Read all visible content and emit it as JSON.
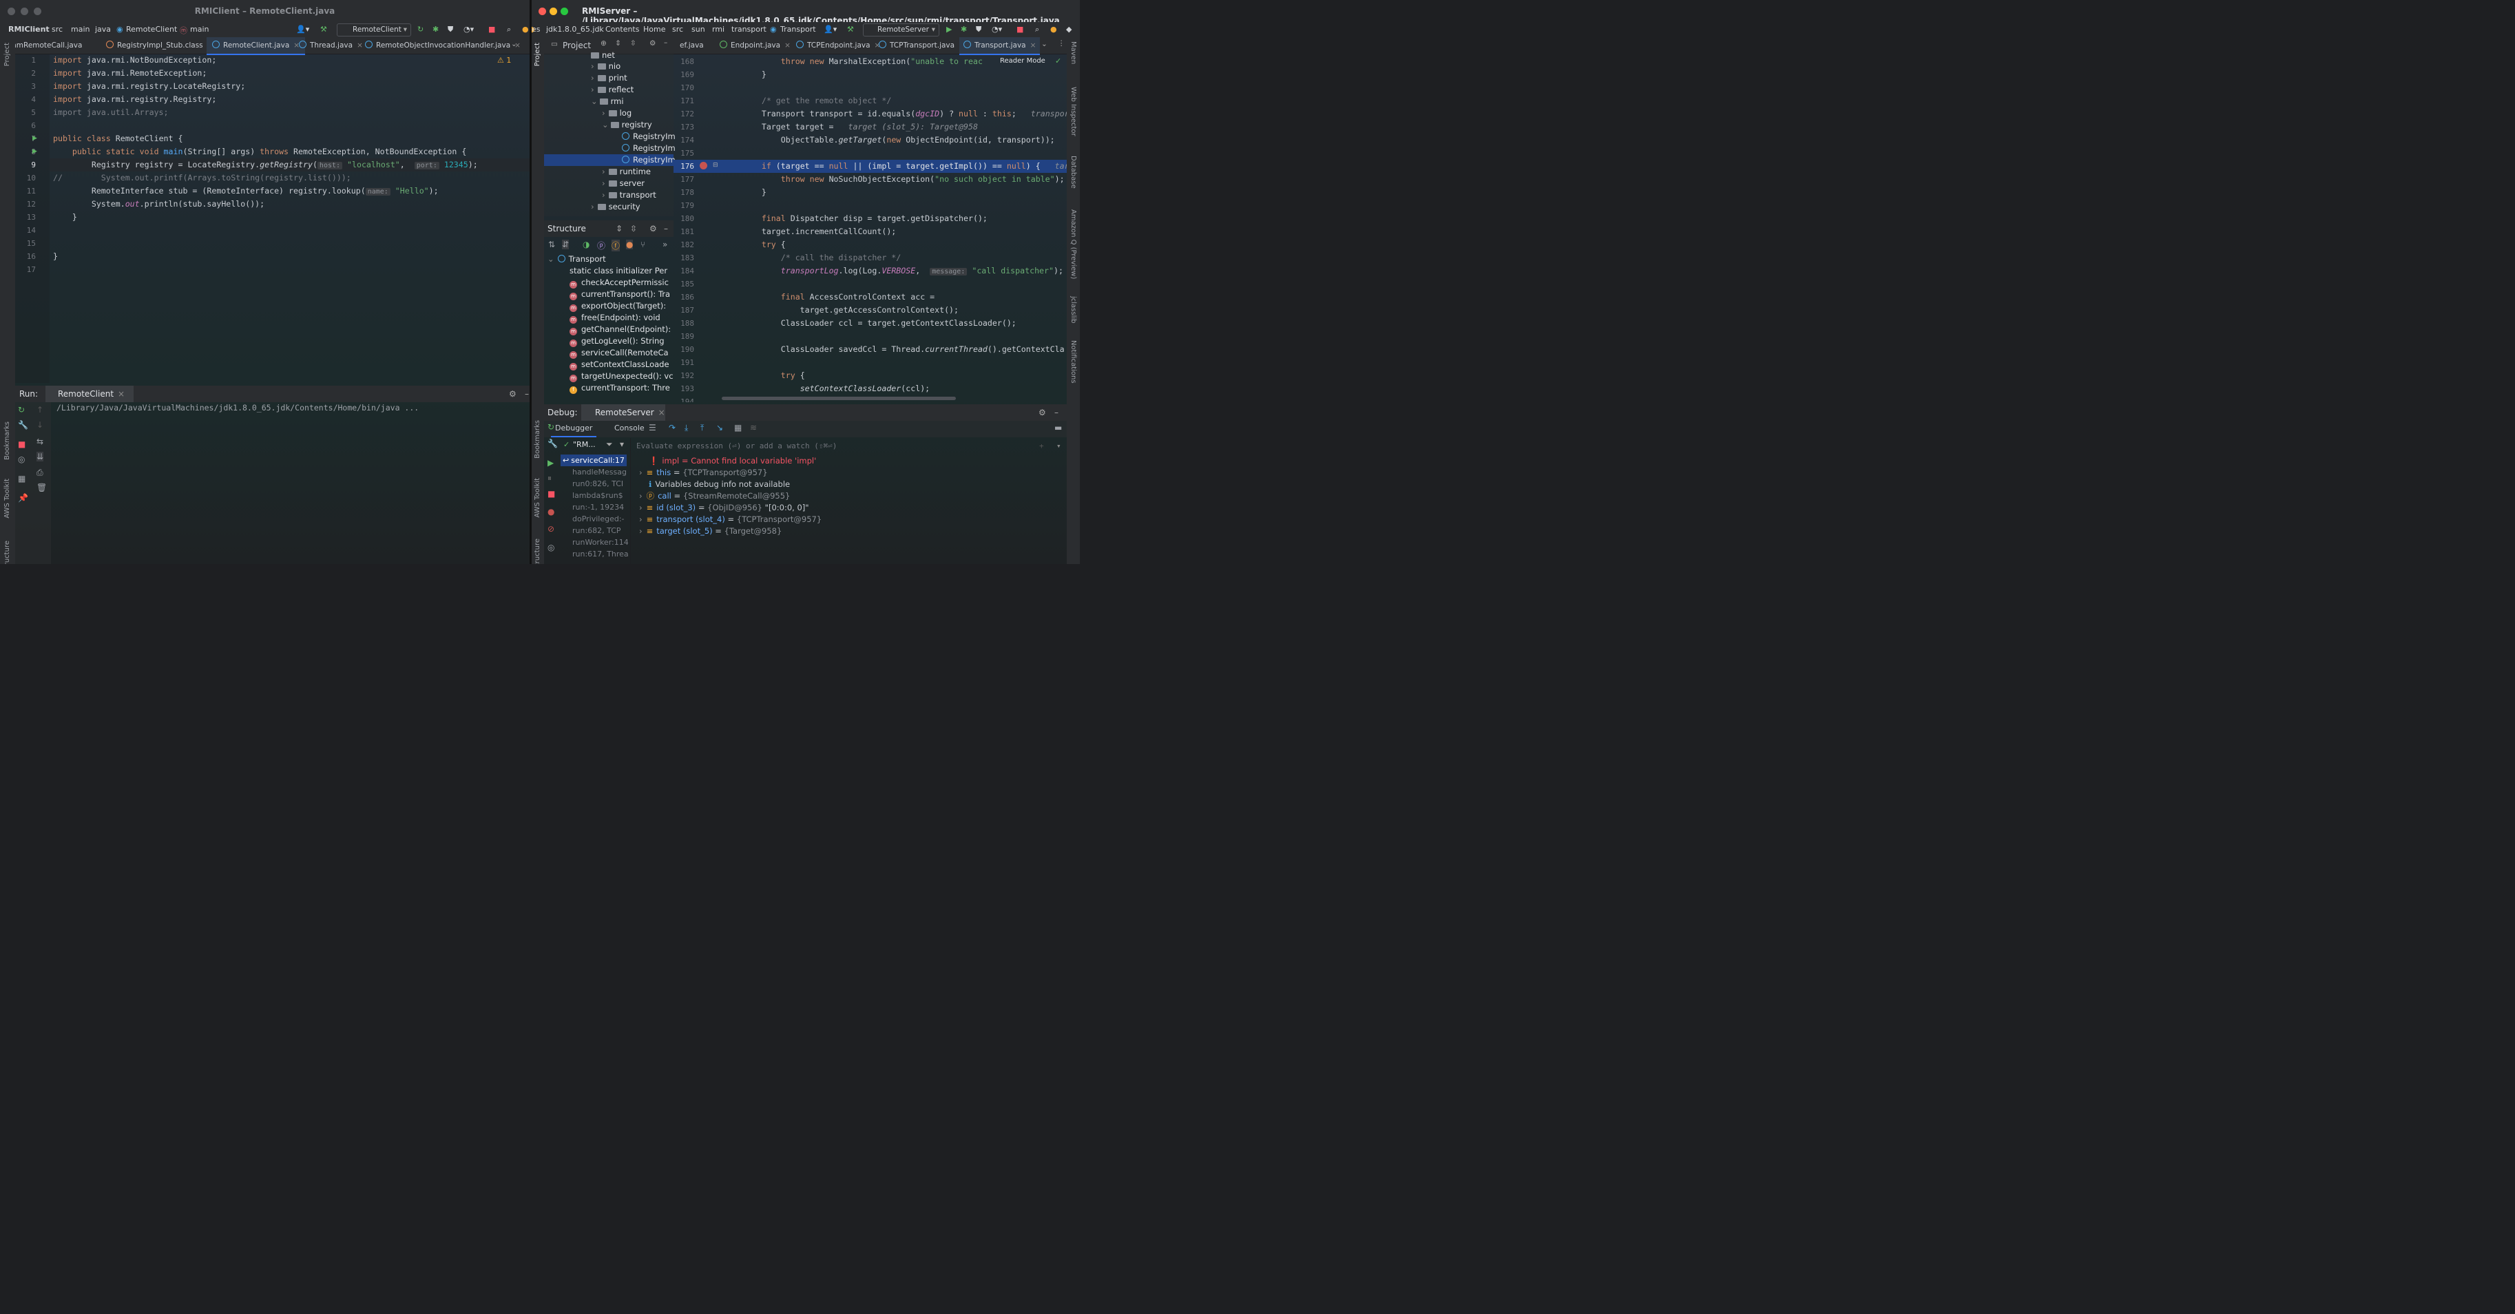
{
  "left": {
    "title": "RMIClient – RemoteClient.java",
    "breadcrumbs": [
      "RMIClient",
      "src",
      "main",
      "java",
      "RemoteClient",
      "main"
    ],
    "run_config": "RemoteClient",
    "tabs": [
      "StreamRemoteCall.java",
      "RegistryImpl_Stub.class",
      "RemoteClient.java",
      "Thread.java",
      "RemoteObjectInvocationHandler.java"
    ],
    "warning_count": "1",
    "code": {
      "l1": "import java.rmi.NotBoundException;",
      "l2": "import java.rmi.RemoteException;",
      "l3": "import java.rmi.registry.LocateRegistry;",
      "l4": "import java.rmi.registry.Registry;",
      "l5": "import java.util.Arrays;",
      "l7a": "public class",
      "l7b": " RemoteClient {",
      "l8a": "    public static void ",
      "l8b": "main",
      "l8c": "(String[] args) ",
      "l8d": "throws",
      "l8e": " RemoteException, NotBoundException {",
      "l9a": "        Registry registry = LocateRegistry.",
      "l9b": "getRegistry",
      "l9c": "(",
      "l9h1": "host:",
      "l9d": " \"localhost\"",
      "l9e": ",  ",
      "l9h2": "port:",
      "l9f": " 12345",
      "l9g": ");",
      "l10a": "//",
      "l10b": "        System.out.printf(Arrays.toString(registry.list()));",
      "l11a": "        RemoteInterface stub = (RemoteInterface) registry.lookup(",
      "l11h": "name:",
      "l11b": " \"Hello\"",
      "l11c": ");",
      "l12a": "        System.",
      "l12b": "out",
      "l12c": ".println(stub.sayHello());",
      "l13": "    }",
      "l16": "}"
    },
    "run_label": "Run:",
    "run_tab": "RemoteClient",
    "run_output": "/Library/Java/JavaVirtualMachines/jdk1.8.0_65.jdk/Contents/Home/bin/java ..."
  },
  "right": {
    "title": "RMIServer – /Library/Java/JavaVirtualMachines/jdk1.8.0_65.jdk/Contents/Home/src/sun/rmi/transport/Transport.java",
    "breadcrumbs": [
      "es",
      "jdk1.8.0_65.jdk",
      "Contents",
      "Home",
      "src",
      "sun",
      "rmi",
      "transport",
      "Transport"
    ],
    "run_config": "RemoteServer",
    "project_label": "Project",
    "tabs": [
      "ef.java",
      "Endpoint.java",
      "TCPEndpoint.java",
      "TCPTransport.java",
      "Transport.java"
    ],
    "reader_mode": "Reader Mode",
    "tree": [
      "net",
      "nio",
      "print",
      "reflect",
      "rmi",
      "log",
      "registry",
      "RegistryIm",
      "RegistryIm",
      "RegistryIm",
      "runtime",
      "server",
      "transport",
      "security"
    ],
    "structure_label": "Structure",
    "structure_root": "Transport",
    "structure_items": [
      "static class initializer Per",
      "checkAcceptPermissic",
      "currentTransport(): Tra",
      "exportObject(Target):",
      "free(Endpoint): void",
      "getChannel(Endpoint):",
      "getLogLevel(): String",
      "serviceCall(RemoteCa",
      "setContextClassLoade",
      "targetUnexpected(): vc",
      "currentTransport: Thre"
    ],
    "line_numbers": [
      "168",
      "169",
      "170",
      "171",
      "172",
      "173",
      "174",
      "175",
      "176",
      "177",
      "178",
      "179",
      "180",
      "181",
      "182",
      "183",
      "184",
      "185",
      "186",
      "187",
      "188",
      "189",
      "190",
      "191",
      "192",
      "193",
      "194"
    ],
    "code": {
      "c168a": "            ",
      "c168b": "throw new",
      "c168c": " MarshalException(",
      "c168d": "\"unable to reac",
      "c169": "        }",
      "c171": "        /* get the remote object */",
      "c172a": "        Transport transport = id.equals(",
      "c172b": "dgcID",
      "c172c": ") ? ",
      "c172d": "null",
      "c172e": " : ",
      "c172f": "this",
      "c172g": ";   ",
      "c172h": "transpor",
      "c173a": "        Target target =   ",
      "c173b": "target (slot_5): Target@958",
      "c174a": "            ObjectTable.",
      "c174b": "getTarget",
      "c174c": "(",
      "c174d": "new",
      "c174e": " ObjectEndpoint(id, transport));",
      "c176a": "        ",
      "c176b": "if",
      "c176c": " (target == ",
      "c176d": "null",
      "c176e": " || (impl = target.getImpl()) == ",
      "c176f": "null",
      "c176g": ") {   ",
      "c176h": "tar",
      "c177a": "            ",
      "c177b": "throw new",
      "c177c": " NoSuchObjectException(",
      "c177d": "\"no such object in table\"",
      "c177e": ");",
      "c178": "        }",
      "c180a": "        ",
      "c180b": "final",
      "c180c": " Dispatcher disp = target.getDispatcher();",
      "c181": "        target.incrementCallCount();",
      "c182a": "        ",
      "c182b": "try",
      "c182c": " {",
      "c183": "            /* call the dispatcher */",
      "c184a": "            ",
      "c184b": "transportLog",
      "c184c": ".log(Log.",
      "c184d": "VERBOSE",
      "c184e": ",  ",
      "c184h": "message:",
      "c184f": " \"call dispatcher\"",
      "c184g": ");",
      "c186a": "            ",
      "c186b": "final",
      "c186c": " AccessControlContext acc =",
      "c187": "                target.getAccessControlContext();",
      "c188": "            ClassLoader ccl = target.getContextClassLoader();",
      "c190a": "            ClassLoader savedCcl = Thread.",
      "c190b": "currentThread",
      "c190c": "().getContextCla",
      "c192a": "            ",
      "c192b": "try",
      "c192c": " {",
      "c193a": "                ",
      "c193b": "setContextClassLoader",
      "c193c": "(ccl);"
    },
    "debug_label": "Debug:",
    "debug_tab": "RemoteServer",
    "debugger_tab": "Debugger",
    "console_tab": "Console",
    "thread": "\"RM...",
    "eval_placeholder": "Evaluate expression (⏎) or add a watch (⇧⌘⏎)",
    "frames": [
      "serviceCall:17",
      "handleMessag",
      "run0:826, TCI",
      "lambda$run$",
      "run:-1, 19234",
      "doPrivileged:-",
      "run:682, TCP",
      "runWorker:114",
      "run:617, Threa"
    ],
    "variables": [
      {
        "name": "impl",
        "sep": " = ",
        "value": "Cannot find local variable 'impl'"
      },
      {
        "name": "this",
        "sep": " = ",
        "value": "{TCPTransport@957}"
      },
      {
        "name": "Variables debug info not available",
        "sep": "",
        "value": ""
      },
      {
        "name": "call",
        "sep": " = ",
        "value": "{StreamRemoteCall@955}"
      },
      {
        "name": "id (slot_3)",
        "sep": " = ",
        "value": "{ObjID@956}",
        "extra": " \"[0:0:0, 0]\""
      },
      {
        "name": "transport (slot_4)",
        "sep": " = ",
        "value": "{TCPTransport@957}"
      },
      {
        "name": "target (slot_5)",
        "sep": " = ",
        "value": "{Target@958}"
      }
    ],
    "side_tools": [
      "Maven",
      "Web Inspector",
      "Database",
      "Amazon Q (Preview)",
      "jclasslib",
      "Notifications"
    ]
  },
  "left_side_tools": [
    "Project",
    "Bookmarks",
    "AWS Toolkit",
    "Structure"
  ],
  "right_left_side_tools": [
    "Project",
    "Bookmarks",
    "AWS Toolkit",
    "Structure"
  ],
  "colors": {
    "accent": "#3574f0",
    "keyword": "#cf8e6d",
    "string": "#6aab73",
    "selection": "#214283",
    "error": "#f75464"
  }
}
